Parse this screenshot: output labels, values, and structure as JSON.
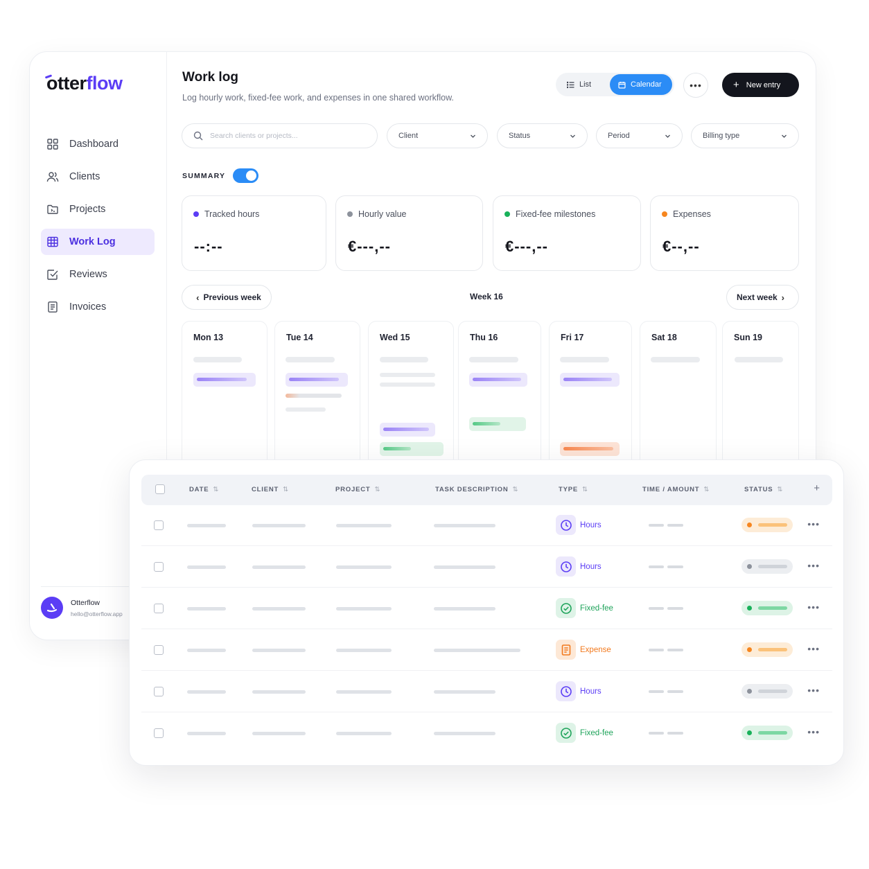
{
  "brand": {
    "name_prefix": "otter",
    "name_suffix": "flow",
    "accent": "#5b3df5"
  },
  "sidebar": {
    "items": [
      {
        "label": "Dashboard",
        "icon": "grid-icon"
      },
      {
        "label": "Clients",
        "icon": "users-icon"
      },
      {
        "label": "Projects",
        "icon": "folder-icon"
      },
      {
        "label": "Work Log",
        "icon": "table-icon",
        "active": true
      },
      {
        "label": "Reviews",
        "icon": "checkbox-icon"
      },
      {
        "label": "Invoices",
        "icon": "invoice-icon"
      }
    ],
    "user": {
      "name": "Otterflow",
      "email": "hello@otterflow.app"
    }
  },
  "header": {
    "title": "Work log",
    "subtitle": "Log hourly work, fixed-fee work, and expenses in one shared workflow.",
    "view_list": "List",
    "view_calendar": "Calendar",
    "active_view": "Calendar",
    "more": "•••",
    "new_entry": "New entry"
  },
  "filters": {
    "search_placeholder": "Search clients or projects...",
    "client": "Client",
    "status": "Status",
    "period": "Period",
    "billing_type": "Billing type"
  },
  "summary": {
    "label": "SUMMARY",
    "enabled": true,
    "cards": [
      {
        "label": "Tracked hours",
        "value": "--:--",
        "color": "#5b3df5"
      },
      {
        "label": "Hourly value",
        "value": "€---,--",
        "color": "#8d929c"
      },
      {
        "label": "Fixed-fee milestones",
        "value": "€---,--",
        "color": "#19b15a"
      },
      {
        "label": "Expenses",
        "value": "€--,--",
        "color": "#f6861f"
      }
    ]
  },
  "week": {
    "prev": "Previous week",
    "label": "Week 16",
    "next": "Next week",
    "days": [
      "Mon 13",
      "Tue 14",
      "Wed 15",
      "Thu 16",
      "Fri 17",
      "Sat 18",
      "Sun 19"
    ]
  },
  "table": {
    "columns": [
      "DATE",
      "CLIENT",
      "PROJECT",
      "TASK DESCRIPTION",
      "TYPE",
      "TIME / AMOUNT",
      "STATUS"
    ],
    "rows": [
      {
        "type": "Hours",
        "status": "orange"
      },
      {
        "type": "Hours",
        "status": "gray"
      },
      {
        "type": "Fixed-fee",
        "status": "green"
      },
      {
        "type": "Expense",
        "status": "orange"
      },
      {
        "type": "Hours",
        "status": "gray"
      },
      {
        "type": "Fixed-fee",
        "status": "green"
      }
    ]
  },
  "colors": {
    "primary_blue": "#2b8cf6",
    "hours": "#5b3df5",
    "fixed_fee": "#1ea35a",
    "expense": "#f2791d"
  }
}
